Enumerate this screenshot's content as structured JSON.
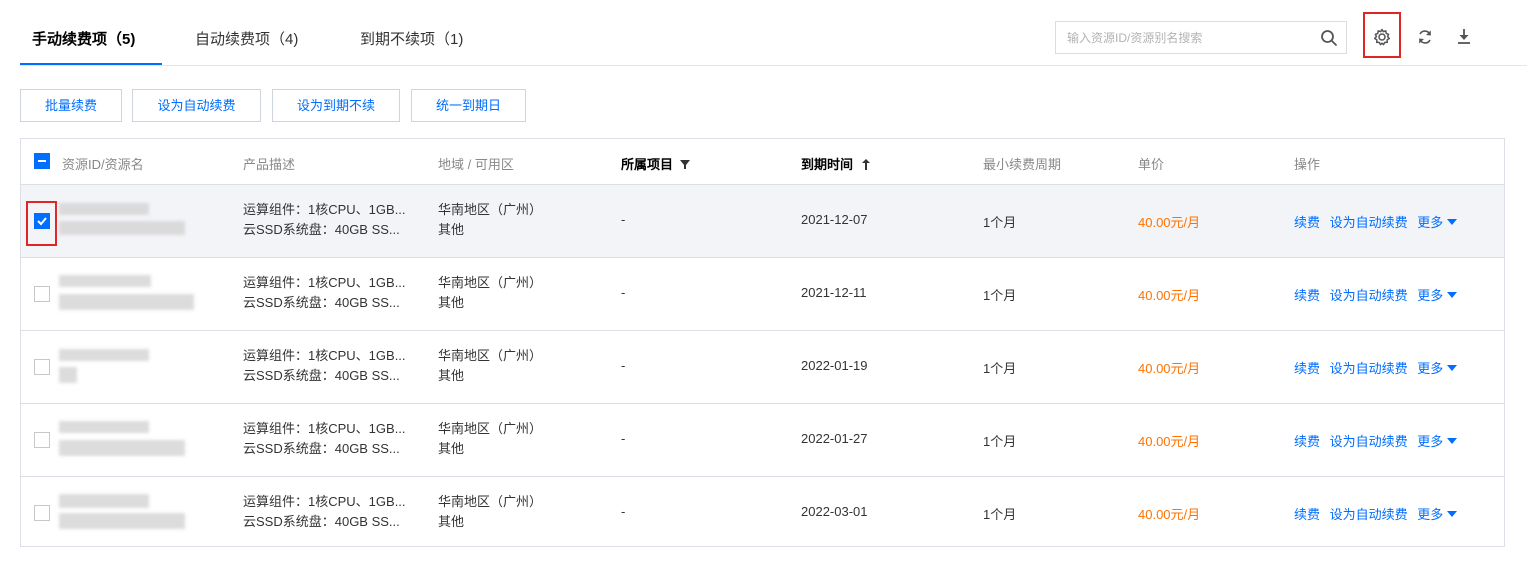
{
  "tabs": [
    {
      "label": "手动续费项（5)",
      "active": true
    },
    {
      "label": "自动续费项（4)",
      "active": false
    },
    {
      "label": "到期不续项（1)",
      "active": false
    }
  ],
  "search": {
    "placeholder": "输入资源ID/资源别名搜索"
  },
  "toolbar_icons": [
    "search-icon",
    "gear-icon",
    "refresh-icon",
    "download-icon"
  ],
  "actions": {
    "batch_renew": "批量续费",
    "set_auto": "设为自动续费",
    "set_no_renew": "设为到期不续",
    "unify_expiry": "统一到期日"
  },
  "table": {
    "headers": {
      "resource": "资源ID/资源名",
      "product": "产品描述",
      "region": "地域 / 可用区",
      "project": "所属项目",
      "expiry": "到期时间",
      "min_cycle": "最小续费周期",
      "price": "单价",
      "ops": "操作"
    },
    "rows": [
      {
        "selected": true,
        "product_line1": "运算组件：1核CPU、1GB...",
        "product_line2": "云SSD系统盘：40GB SS...",
        "region_line1": "华南地区（广州）",
        "region_line2": "其他",
        "project": "-",
        "expiry": "2021-12-07",
        "min_cycle": "1个月",
        "price": "40.00元/月",
        "op_renew": "续费",
        "op_auto": "设为自动续费",
        "op_more": "更多"
      },
      {
        "selected": false,
        "product_line1": "运算组件：1核CPU、1GB...",
        "product_line2": "云SSD系统盘：40GB SS...",
        "region_line1": "华南地区（广州）",
        "region_line2": "其他",
        "project": "-",
        "expiry": "2021-12-11",
        "min_cycle": "1个月",
        "price": "40.00元/月",
        "op_renew": "续费",
        "op_auto": "设为自动续费",
        "op_more": "更多"
      },
      {
        "selected": false,
        "product_line1": "运算组件：1核CPU、1GB...",
        "product_line2": "云SSD系统盘：40GB SS...",
        "region_line1": "华南地区（广州）",
        "region_line2": "其他",
        "project": "-",
        "expiry": "2022-01-19",
        "min_cycle": "1个月",
        "price": "40.00元/月",
        "op_renew": "续费",
        "op_auto": "设为自动续费",
        "op_more": "更多"
      },
      {
        "selected": false,
        "product_line1": "运算组件：1核CPU、1GB...",
        "product_line2": "云SSD系统盘：40GB SS...",
        "region_line1": "华南地区（广州）",
        "region_line2": "其他",
        "project": "-",
        "expiry": "2022-01-27",
        "min_cycle": "1个月",
        "price": "40.00元/月",
        "op_renew": "续费",
        "op_auto": "设为自动续费",
        "op_more": "更多"
      },
      {
        "selected": false,
        "product_line1": "运算组件：1核CPU、1GB...",
        "product_line2": "云SSD系统盘：40GB SS...",
        "region_line1": "华南地区（广州）",
        "region_line2": "其他",
        "project": "-",
        "expiry": "2022-03-01",
        "min_cycle": "1个月",
        "price": "40.00元/月",
        "op_renew": "续费",
        "op_auto": "设为自动续费",
        "op_more": "更多"
      }
    ]
  },
  "colors": {
    "accent": "#006eff",
    "price": "#ff7200",
    "highlight": "#e12525",
    "selected_row": "#f2f4f8"
  }
}
